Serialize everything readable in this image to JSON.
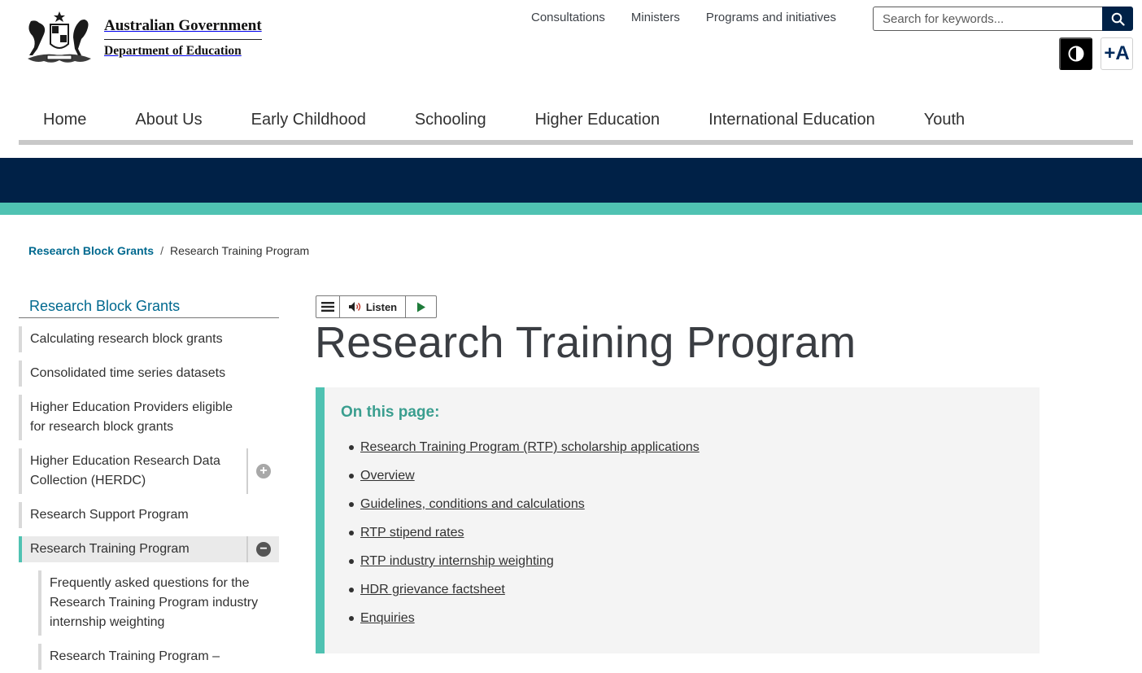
{
  "header": {
    "logo": {
      "line1": "Australian Government",
      "line2": "Department of Education"
    },
    "utility_links": [
      "Consultations",
      "Ministers",
      "Programs and initiatives"
    ],
    "search": {
      "placeholder": "Search for keywords..."
    },
    "text_size_label": "+A"
  },
  "nav": [
    "Home",
    "About Us",
    "Early Childhood",
    "Schooling",
    "Higher Education",
    "International Education",
    "Youth"
  ],
  "breadcrumb": {
    "parent": "Research Block Grants",
    "separator": "/",
    "current": "Research Training Program"
  },
  "sidebar": {
    "title": "Research Block Grants",
    "items": [
      "Calculating research block grants",
      "Consolidated time series datasets",
      "Higher Education Providers eligible for research block grants",
      "Higher Education Research Data Collection (HERDC)",
      "Research Support Program",
      "Research Training Program"
    ],
    "sub_items": [
      "Frequently asked questions for the Research Training Program industry internship weighting",
      "Research Training Program –"
    ]
  },
  "listen": {
    "label": "Listen"
  },
  "main": {
    "title": "Research Training Program",
    "on_this_page": {
      "title": "On this page:",
      "links": [
        "Research Training Program (RTP) scholarship applications",
        "Overview",
        "Guidelines, conditions and calculations",
        "RTP stipend rates",
        "RTP industry internship weighting",
        "HDR grievance factsheet",
        "Enquiries"
      ]
    }
  },
  "colors": {
    "navy": "#002147",
    "teal": "#4fc2b2",
    "link": "#00698f",
    "otp_title": "#3a9e8f"
  }
}
